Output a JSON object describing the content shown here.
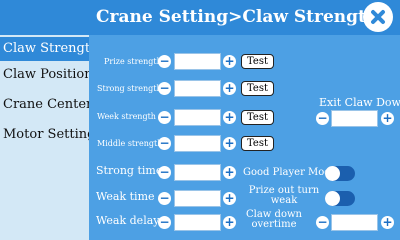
{
  "header": {
    "title": "Crane Setting>Claw Strength"
  },
  "sidebar": {
    "items": [
      {
        "label": "Claw Strength",
        "active": true
      },
      {
        "label": "Claw Position"
      },
      {
        "label": "Crane Center"
      },
      {
        "label": "Motor Setting"
      }
    ]
  },
  "strength": {
    "prize_label": "Prize strength",
    "strong_label": "Strong strength",
    "week_label": "Week strength",
    "middle_label": "Middle strength",
    "test_label": "Test",
    "prize_value": "",
    "strong_value": "",
    "week_value": "",
    "middle_value": ""
  },
  "timing": {
    "strong_time_label": "Strong time",
    "weak_time_label": "Weak time",
    "weak_delay_label": "Weak delay",
    "strong_time_value": "",
    "weak_time_value": "",
    "weak_delay_value": ""
  },
  "exit_claw_down": {
    "label": "Exit Claw Down",
    "value": ""
  },
  "good_player_mode": {
    "label": "Good Player Mode",
    "enabled": false
  },
  "prize_out_turn_weak": {
    "label_line1": "Prize out turn",
    "label_line2": "weak",
    "enabled": false
  },
  "claw_down_overtime": {
    "label_line1": "Claw down",
    "label_line2": "overtime",
    "value": ""
  },
  "icons": {
    "close": "close-icon",
    "minus": "minus-icon",
    "plus": "plus-icon"
  },
  "colors": {
    "primary": "#2f89d8",
    "panel": "#4da0e4",
    "sidebar": "#d3e8f6",
    "toggle_off": "#1b5fae"
  }
}
